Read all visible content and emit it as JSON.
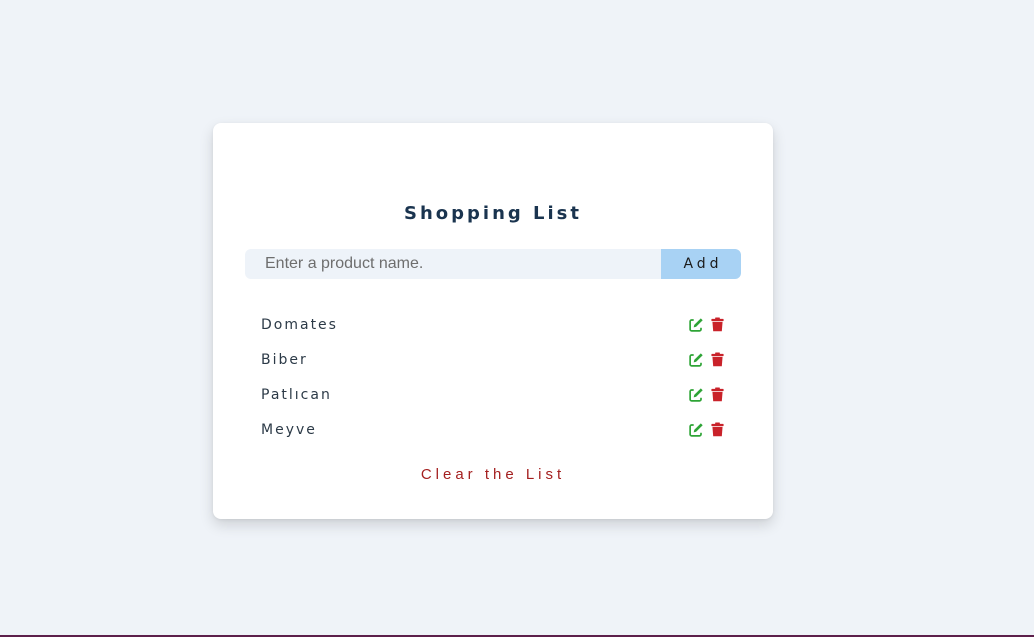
{
  "title": "Shopping List",
  "form": {
    "input_value": "",
    "input_placeholder": "Enter a product name.",
    "add_label": "Add"
  },
  "items": [
    {
      "name": "Domates"
    },
    {
      "name": "Biber"
    },
    {
      "name": "Patlıcan"
    },
    {
      "name": "Meyve"
    }
  ],
  "icons": {
    "edit": "edit-icon",
    "delete": "trash-icon"
  },
  "clear_label": "Clear the List",
  "colors": {
    "background": "#eff3f8",
    "title": "#1a344f",
    "add_button": "#a8d2f4",
    "edit_icon": "#2ea436",
    "delete_icon": "#c9222a",
    "clear_text": "#a41f1f"
  }
}
